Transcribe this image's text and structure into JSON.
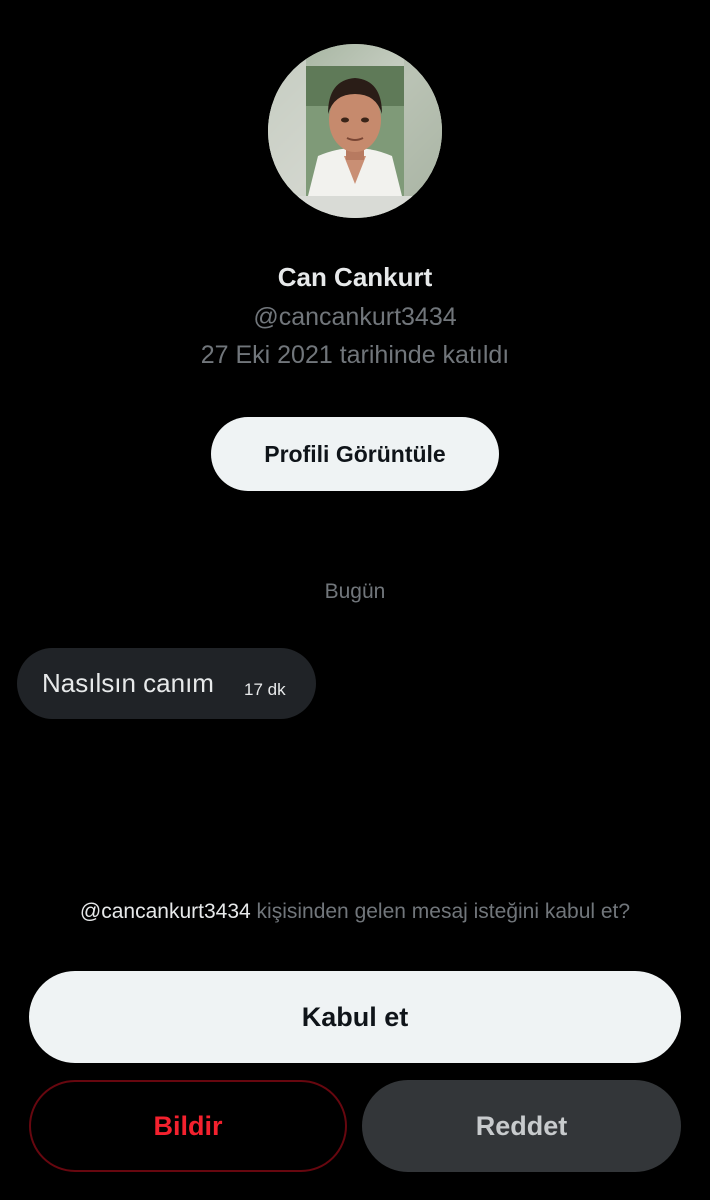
{
  "profile": {
    "name": "Can Cankurt",
    "handle": "@cancankurt3434",
    "joined": "27 Eki 2021 tarihinde katıldı",
    "view_profile_label": "Profili Görüntüle"
  },
  "conversation": {
    "date_divider": "Bugün",
    "messages": [
      {
        "text": "Nasılsın canım",
        "time": "17 dk"
      }
    ]
  },
  "request": {
    "handle": "@cancankurt3434",
    "prompt": " kişisinden gelen mesaj isteğini kabul et?",
    "accept_label": "Kabul et",
    "report_label": "Bildir",
    "decline_label": "Reddet"
  },
  "colors": {
    "background": "#000000",
    "primary_text": "#e7e9ea",
    "secondary_text": "#71767b",
    "light_button": "#eff3f4",
    "danger": "#f4212e",
    "dark_button": "#333639"
  }
}
